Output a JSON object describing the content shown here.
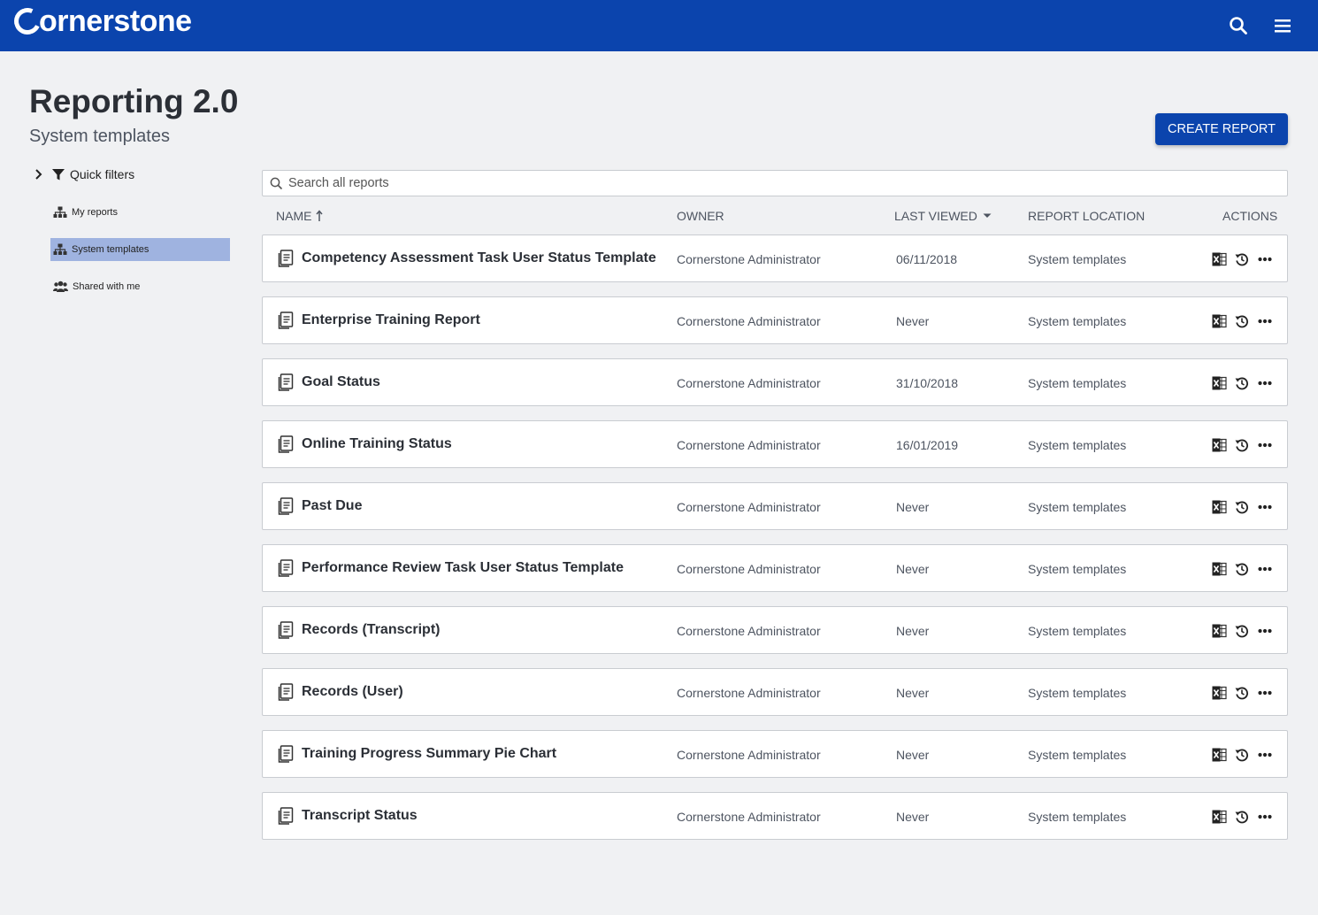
{
  "header": {
    "logo_text": "ornerstone",
    "icons": {
      "search": "search-icon",
      "menu": "hamburger-menu-icon"
    }
  },
  "page": {
    "title": "Reporting 2.0",
    "subtitle": "System templates",
    "create_button": "CREATE REPORT"
  },
  "sidebar": {
    "quick_filters": "Quick filters",
    "items": [
      {
        "label": "My reports",
        "icon": "hierarchy-icon"
      },
      {
        "label": "System templates",
        "icon": "hierarchy-icon",
        "active": true
      },
      {
        "label": "Shared with me",
        "icon": "users-icon"
      }
    ]
  },
  "search": {
    "placeholder": "Search all reports",
    "value": ""
  },
  "table": {
    "columns": {
      "name": "NAME",
      "owner": "OWNER",
      "last_viewed": "LAST VIEWED",
      "location": "REPORT LOCATION",
      "actions": "ACTIONS"
    },
    "rows": [
      {
        "name": "Competency Assessment Task User Status Template",
        "owner": "Cornerstone Administrator",
        "last_viewed": "06/11/2018",
        "location": "System templates"
      },
      {
        "name": "Enterprise Training Report",
        "owner": "Cornerstone Administrator",
        "last_viewed": "Never",
        "location": "System templates"
      },
      {
        "name": "Goal Status",
        "owner": "Cornerstone Administrator",
        "last_viewed": "31/10/2018",
        "location": "System templates"
      },
      {
        "name": "Online Training Status",
        "owner": "Cornerstone Administrator",
        "last_viewed": "16/01/2019",
        "location": "System templates"
      },
      {
        "name": "Past Due",
        "owner": "Cornerstone Administrator",
        "last_viewed": "Never",
        "location": "System templates"
      },
      {
        "name": "Performance Review Task User Status Template",
        "owner": "Cornerstone Administrator",
        "last_viewed": "Never",
        "location": "System templates"
      },
      {
        "name": "Records (Transcript)",
        "owner": "Cornerstone Administrator",
        "last_viewed": "Never",
        "location": "System templates"
      },
      {
        "name": "Records (User)",
        "owner": "Cornerstone Administrator",
        "last_viewed": "Never",
        "location": "System templates"
      },
      {
        "name": "Training Progress Summary Pie Chart",
        "owner": "Cornerstone Administrator",
        "last_viewed": "Never",
        "location": "System templates"
      },
      {
        "name": "Transcript Status",
        "owner": "Cornerstone Administrator",
        "last_viewed": "Never",
        "location": "System templates"
      }
    ]
  },
  "colors": {
    "brand": "#0b44ad",
    "active_nav": "#9fb3e0",
    "background": "#f0f1f3"
  }
}
